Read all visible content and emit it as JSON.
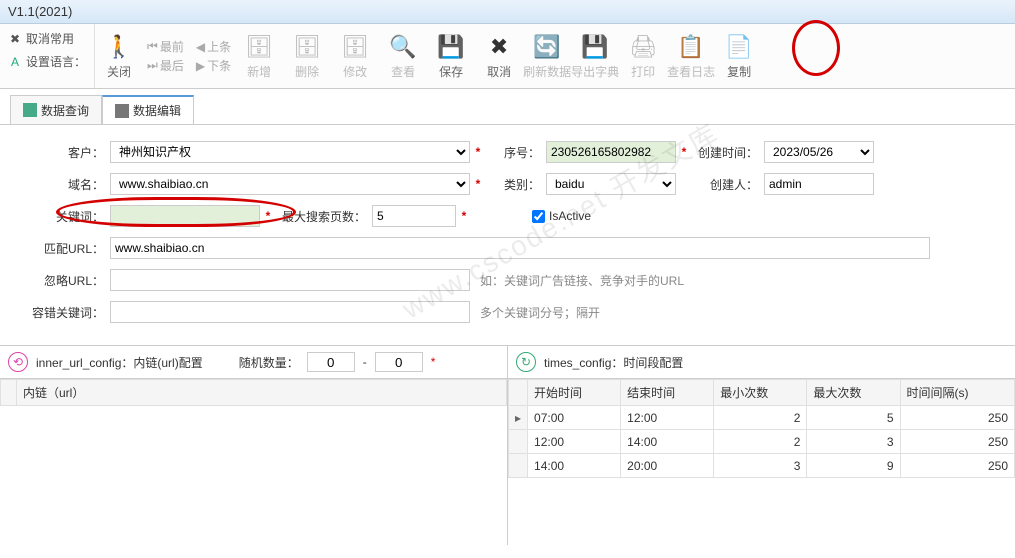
{
  "window": {
    "title": "V1.1(2021)"
  },
  "smallTools": {
    "cancel_common": "取消常用",
    "set_lang": "设置语言："
  },
  "navBtns": {
    "first": "最前",
    "last": "最后",
    "prev": "上条",
    "next": "下条"
  },
  "toolbar": {
    "close": "关闭",
    "add": "新增",
    "delete": "删除",
    "edit": "修改",
    "view": "查看",
    "save": "保存",
    "cancel": "取消",
    "refresh": "刷新数据",
    "export_dict": "导出字典",
    "print": "打印",
    "view_log": "查看日志",
    "copy": "复制"
  },
  "tabs": {
    "data_query": "数据查询",
    "data_edit": "数据编辑"
  },
  "form": {
    "customer_label": "客户：",
    "customer_value": "神州知识产权",
    "domain_label": "域名：",
    "domain_value": "www.shaibiao.cn",
    "keyword_label": "关键词：",
    "keyword_value": "",
    "max_pages_label": "最大搜索页数：",
    "max_pages_value": "5",
    "match_url_label": "匹配URL：",
    "match_url_value": "www.shaibiao.cn",
    "ignore_url_label": "忽略URL：",
    "ignore_url_hint": "如：关键词广告链接、竞争对手的URL",
    "fault_kw_label": "容错关键词：",
    "fault_kw_hint": "多个关键词分号；隔开",
    "seq_label": "序号：",
    "seq_value": "230526165802982",
    "category_label": "类别：",
    "category_value": "baidu",
    "isactive_label": "IsActive",
    "created_time_label": "创建时间：",
    "created_time_value": "2023/05/26",
    "created_by_label": "创建人：",
    "created_by_value": "admin"
  },
  "panels": {
    "inner": {
      "title": "inner_url_config：内链(url)配置",
      "random_label": "随机数量：",
      "min": "0",
      "max": "0",
      "col_url": "内链（url）"
    },
    "times": {
      "title": "times_config：时间段配置",
      "cols": {
        "start": "开始时间",
        "end": "结束时间",
        "min": "最小次数",
        "max": "最大次数",
        "interval": "时间间隔(s)"
      },
      "rows": [
        {
          "start": "07:00",
          "end": "12:00",
          "min": 2,
          "max": 5,
          "interval": 250
        },
        {
          "start": "12:00",
          "end": "14:00",
          "min": 2,
          "max": 3,
          "interval": 250
        },
        {
          "start": "14:00",
          "end": "20:00",
          "min": 3,
          "max": 9,
          "interval": 250
        }
      ]
    }
  },
  "asterisk": "*",
  "dash": "-",
  "watermark": "www.cscode.net 开发文库"
}
